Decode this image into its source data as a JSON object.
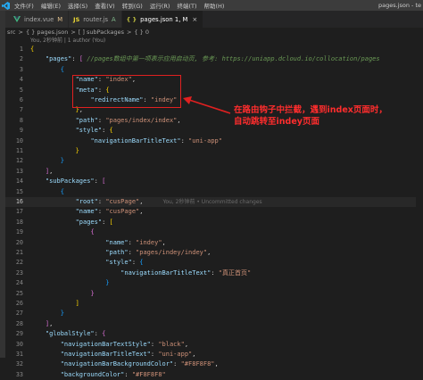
{
  "titlebar": {
    "menu": [
      "文件(F)",
      "编辑(E)",
      "选择(S)",
      "查看(V)",
      "转到(G)",
      "运行(R)",
      "终端(T)",
      "帮助(H)"
    ],
    "window_title": "pages.json - te"
  },
  "tabs": [
    {
      "icon": "Vue",
      "label": "index.vue",
      "status": "M",
      "active": false
    },
    {
      "icon": "JS",
      "label": "router.js",
      "status": "A",
      "active": false
    },
    {
      "icon": "{ }",
      "label": "pages.json 1, M",
      "status": "",
      "active": true
    }
  ],
  "breadcrumb": {
    "items": [
      "src",
      ">",
      "{ } pages.json",
      ">",
      "[ ] subPackages",
      ">",
      "{ } 0"
    ]
  },
  "codelens": "You, 2秒钟前 | 1 author (You)",
  "editor": {
    "current_line": 16,
    "blame_text": "You, 2秒钟前 • Uncommitted changes",
    "lines": [
      {
        "n": "1",
        "t": "{"
      },
      {
        "n": "2",
        "t": "    \"pages\": [ //pages数组中第一项表示应用启动页, 参考: https://uniapp.dcloud.io/collocation/pages"
      },
      {
        "n": "3",
        "t": "        {"
      },
      {
        "n": "4",
        "t": "            \"name\": \"index\","
      },
      {
        "n": "5",
        "t": "            \"meta\": {"
      },
      {
        "n": "6",
        "t": "                \"redirectName\": \"indey\""
      },
      {
        "n": "7",
        "t": "            },"
      },
      {
        "n": "8",
        "t": "            \"path\": \"pages/index/index\","
      },
      {
        "n": "9",
        "t": "            \"style\": {"
      },
      {
        "n": "10",
        "t": "                \"navigationBarTitleText\": \"uni-app\""
      },
      {
        "n": "11",
        "t": "            }"
      },
      {
        "n": "12",
        "t": "        }"
      },
      {
        "n": "13",
        "t": "    ],"
      },
      {
        "n": "14",
        "t": "    \"subPackages\": ["
      },
      {
        "n": "15",
        "t": "        {"
      },
      {
        "n": "16",
        "t": "            \"root\": \"cusPage\","
      },
      {
        "n": "17",
        "t": "            \"name\": \"cusPage\","
      },
      {
        "n": "18",
        "t": "            \"pages\": ["
      },
      {
        "n": "19",
        "t": "                {"
      },
      {
        "n": "20",
        "t": "                    \"name\": \"indey\","
      },
      {
        "n": "21",
        "t": "                    \"path\": \"pages/indey/indey\","
      },
      {
        "n": "22",
        "t": "                    \"style\": {"
      },
      {
        "n": "23",
        "t": "                        \"navigationBarTitleText\": \"真正首页\""
      },
      {
        "n": "24",
        "t": "                    }"
      },
      {
        "n": "25",
        "t": "                }"
      },
      {
        "n": "26",
        "t": "            ]"
      },
      {
        "n": "27",
        "t": "        }"
      },
      {
        "n": "28",
        "t": "    ],"
      },
      {
        "n": "29",
        "t": "    \"globalStyle\": {"
      },
      {
        "n": "30",
        "t": "        \"navigationBarTextStyle\": \"black\","
      },
      {
        "n": "31",
        "t": "        \"navigationBarTitleText\": \"uni-app\","
      },
      {
        "n": "32",
        "t": "        \"navigationBarBackgroundColor\": \"#F8F8F8\","
      },
      {
        "n": "33",
        "t": "        \"backgroundColor\": \"#F8F8F8\""
      }
    ]
  },
  "annotation": {
    "line1": "在路由钩子中拦截，遇到index页面时，",
    "line2": "自动跳转至indey页面"
  },
  "colors": {
    "accent_red": "#e02020",
    "annotation_red": "#ff2d2d",
    "editor_bg": "#1e1e1e"
  }
}
